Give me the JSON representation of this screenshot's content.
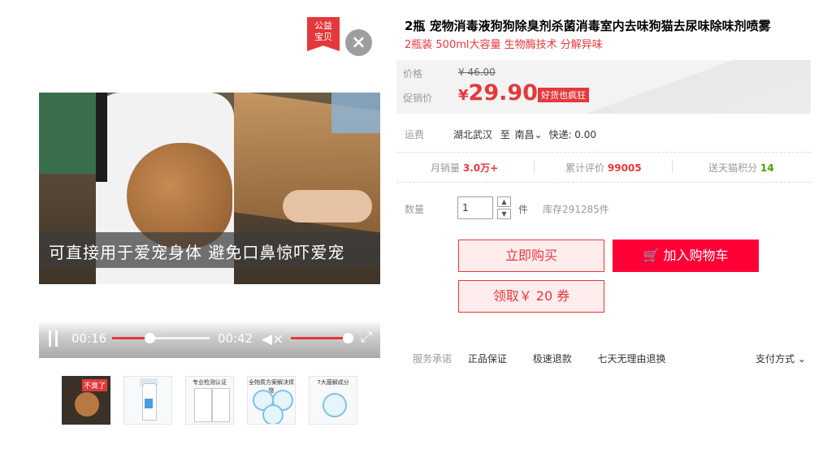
{
  "badge": {
    "line1": "公益",
    "line2": "宝贝"
  },
  "close_icon": "×",
  "video": {
    "subtitle": "可直接用于爱宠身体 避免口鼻惊吓爱宠",
    "current_time": "00:16",
    "total_time": "00:42",
    "progress": 0.38,
    "volume": 1.0
  },
  "thumbnails": [
    {
      "tag": "不臭了"
    },
    {
      "tag": ""
    },
    {
      "tag": "专业检测认证"
    },
    {
      "tag": "全物质方案解决烦恼"
    },
    {
      "tag": "7大菌解成分"
    }
  ],
  "product": {
    "title": "2瓶 宠物消毒液狗狗除臭剂杀菌消毒室内去味狗猫去尿味除味剂喷雾",
    "subtitle": "2瓶装 500ml大容量 生物酶技术 分解异味"
  },
  "price": {
    "orig_label": "价格",
    "orig_value": "¥ 46.00",
    "promo_label": "促销价",
    "currency": "¥",
    "promo_value": "29.90",
    "promo_tag": "好货也疯狂"
  },
  "shipping": {
    "label": "运费",
    "from": "湖北武汉",
    "to_word": "至",
    "dest": "南昌",
    "express": "快递: 0.00"
  },
  "stats": {
    "monthly_label": "月销量",
    "monthly_value": "3.0万+",
    "reviews_label": "累计评价",
    "reviews_value": "99005",
    "points_label": "送天猫积分",
    "points_value": "14"
  },
  "quantity": {
    "label": "数量",
    "value": "1",
    "unit": "件",
    "stock": "库存291285件"
  },
  "buttons": {
    "buy": "立即购买",
    "cart": "加入购物车",
    "coupon": "领取￥ 20 券"
  },
  "services": {
    "label": "服务承诺",
    "items": [
      "正品保证",
      "极速退款",
      "七天无理由退换"
    ],
    "payment": "支付方式"
  },
  "colors": {
    "accent": "#e4393c",
    "cart": "#ff0036",
    "points_green": "#48a300"
  }
}
